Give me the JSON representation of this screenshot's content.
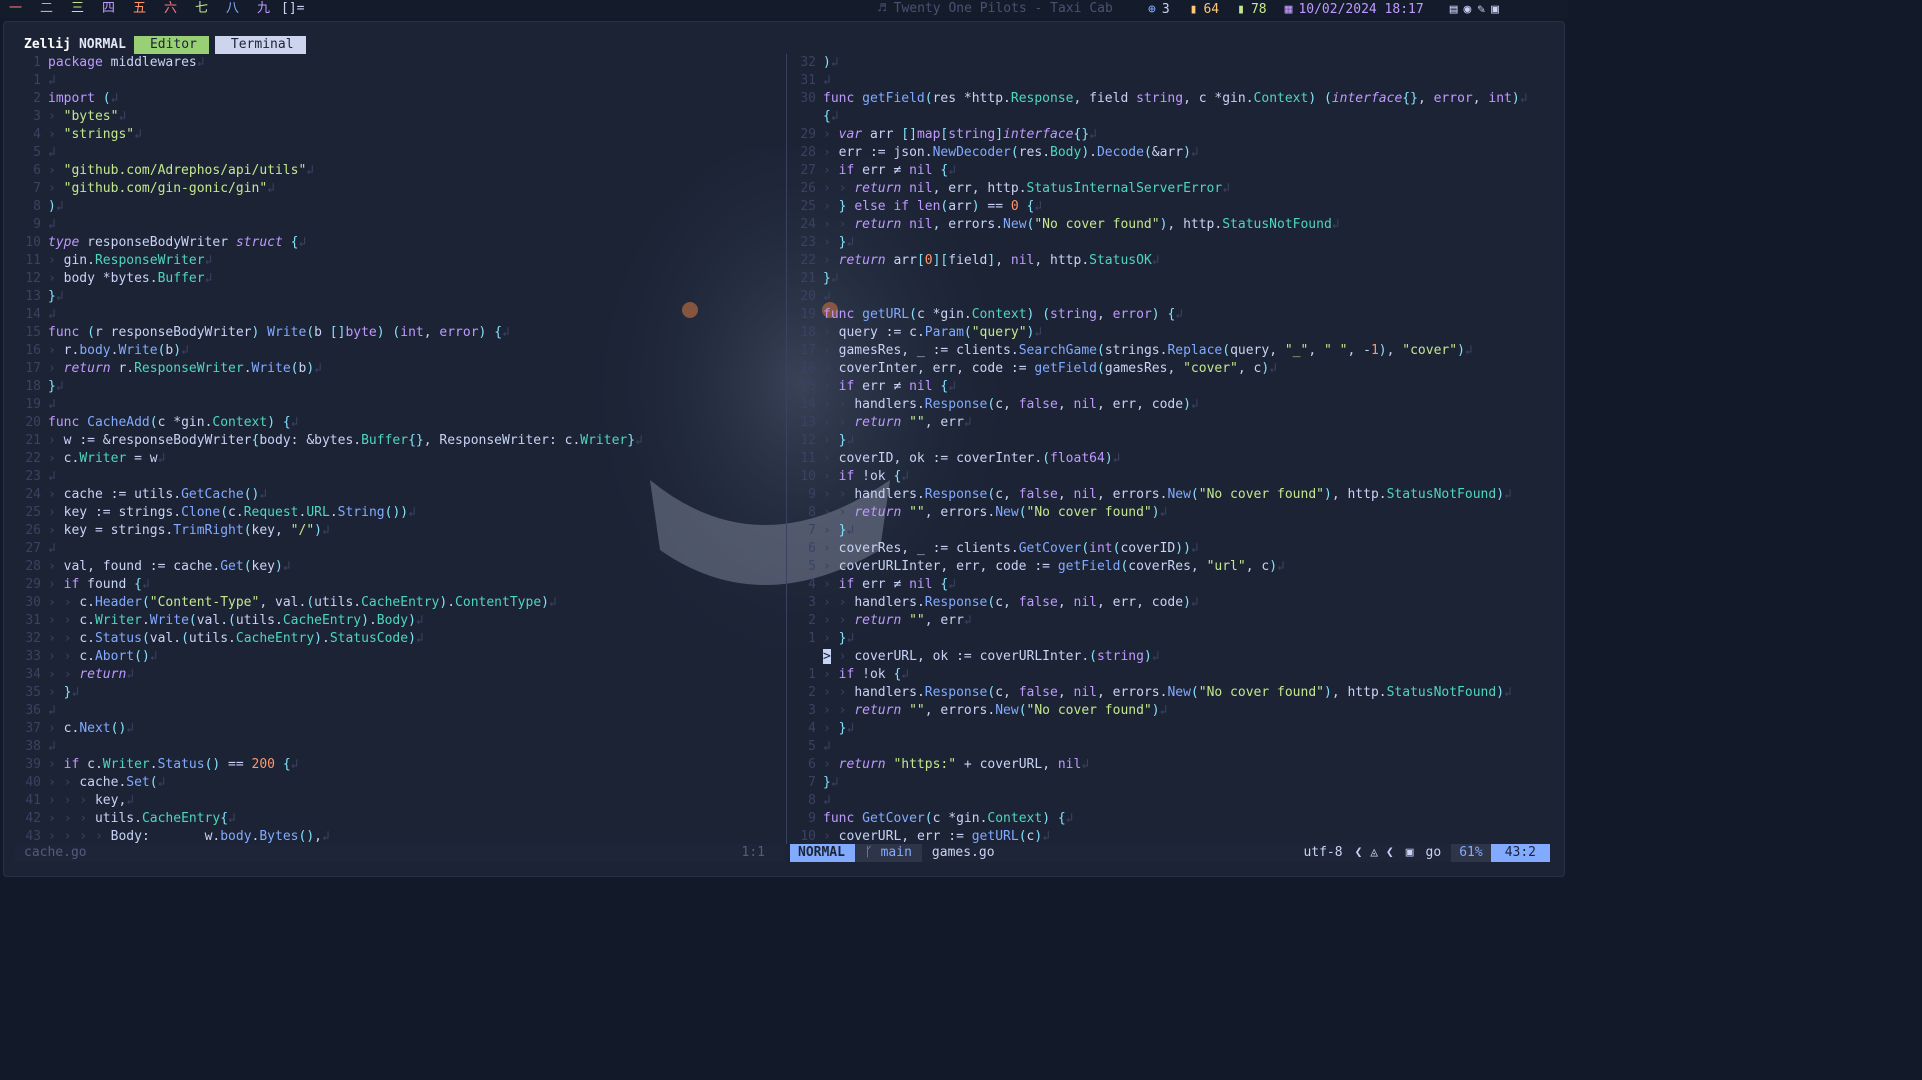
{
  "topbar": {
    "workspaces": [
      "一",
      "二",
      "三",
      "四",
      "五",
      "六",
      "七",
      "八",
      "九"
    ],
    "workspace_colors": [
      "#ff757f",
      "#ff966c",
      "#c3e88d",
      "#c099ff",
      "#ff966c",
      "#ff757f",
      "#c3e88d",
      "#82aaff",
      "#c099ff"
    ],
    "layout": "[]=",
    "music": "♬ Twenty One Pilots - Taxi Cab",
    "tray_count": "3",
    "cpu": "64",
    "battery": "78",
    "datetime": "10/02/2024 18:17"
  },
  "zellij": {
    "name": "Zellij",
    "mode": "NORMAL",
    "tabs": [
      {
        "label": "Editor",
        "active": true
      },
      {
        "label": "Terminal",
        "active": false
      }
    ]
  },
  "left_pane": {
    "filename": "cache.go",
    "position": "1:1",
    "numbers": [
      "1",
      "1",
      "2",
      "3",
      "4",
      "5",
      "6",
      "7",
      "8",
      "9",
      "10",
      "11",
      "12",
      "13",
      "14",
      "15",
      "16",
      "17",
      "18",
      "19",
      "20",
      "21",
      "22",
      "23",
      "24",
      "25",
      "26",
      "27",
      "28",
      "29",
      "30",
      "31",
      "32",
      "33",
      "34",
      "35",
      "36",
      "37",
      "38",
      "39",
      "40",
      "41",
      "42",
      "43"
    ],
    "lines": [
      "package middlewares",
      "",
      "import (",
      "\"bytes\"",
      "\"strings\"",
      "",
      "\"github.com/Adrephos/api/utils\"",
      "\"github.com/gin-gonic/gin\"",
      ")",
      "",
      "type responseBodyWriter struct {",
      "gin.ResponseWriter",
      "body *bytes.Buffer",
      "}",
      "",
      "func (r responseBodyWriter) Write(b []byte) (int, error) {",
      "r.body.Write(b)",
      "return r.ResponseWriter.Write(b)",
      "}",
      "",
      "func CacheAdd(c *gin.Context) {",
      "w := &responseBodyWriter{body: &bytes.Buffer{}, ResponseWriter: c.Writer}",
      "c.Writer = w",
      "",
      "cache := utils.GetCache()",
      "key := strings.Clone(c.Request.URL.String())",
      "key = strings.TrimRight(key, \"/\")",
      "",
      "val, found := cache.Get(key)",
      "if found {",
      "c.Header(\"Content-Type\", val.(utils.CacheEntry).ContentType)",
      "c.Writer.Write(val.(utils.CacheEntry).Body)",
      "c.Status(val.(utils.CacheEntry).StatusCode)",
      "c.Abort()",
      "return",
      "}",
      "",
      "c.Next()",
      "",
      "if c.Writer.Status() == 200 {",
      "cache.Set(",
      "key,",
      "utils.CacheEntry{",
      "Body:       w.body.Bytes(),"
    ]
  },
  "right_pane": {
    "filename": "games.go",
    "mode": "NORMAL",
    "branch": "main",
    "encoding": "utf-8",
    "filetype": "go",
    "percent": "61%",
    "position": "43:2",
    "numbers": [
      "32",
      "31",
      "30",
      "",
      "29",
      "28",
      "27",
      "26",
      "25",
      "24",
      "23",
      "22",
      "21",
      "20",
      "19",
      "18",
      "17",
      "16",
      "15",
      "14",
      "13",
      "12",
      "11",
      "10",
      "9",
      "8",
      "7",
      "6",
      "5",
      "4",
      "3",
      "2",
      "1",
      "",
      "1",
      "2",
      "3",
      "4",
      "5",
      "6",
      "7",
      "8",
      "9",
      "10"
    ],
    "lines": [
      ")",
      "",
      "func getField(res *http.Response, field string, c *gin.Context) (interface{}, error, int)",
      "{",
      "var arr []map[string]interface{}",
      "err := json.NewDecoder(res.Body).Decode(&arr)",
      "if err ≠ nil {",
      "return nil, err, http.StatusInternalServerError",
      "} else if len(arr) == 0 {",
      "return nil, errors.New(\"No cover found\"), http.StatusNotFound",
      "}",
      "return arr[0][field], nil, http.StatusOK",
      "}",
      "",
      "func getURL(c *gin.Context) (string, error) {",
      "query := c.Param(\"query\")",
      "gamesRes, _ := clients.SearchGame(strings.Replace(query, \"_\", \" \", -1), \"cover\")",
      "coverInter, err, code := getField(gamesRes, \"cover\", c)",
      "if err ≠ nil {",
      "handlers.Response(c, false, nil, err, code)",
      "return \"\", err",
      "}",
      "coverID, ok := coverInter.(float64)",
      "if !ok {",
      "handlers.Response(c, false, nil, errors.New(\"No cover found\"), http.StatusNotFound)",
      "return \"\", errors.New(\"No cover found\")",
      "}",
      "coverRes, _ := clients.GetCover(int(coverID))",
      "coverURLInter, err, code := getField(coverRes, \"url\", c)",
      "if err ≠ nil {",
      "handlers.Response(c, false, nil, err, code)",
      "return \"\", err",
      "}",
      "coverURL, ok := coverURLInter.(string)",
      "if !ok {",
      "handlers.Response(c, false, nil, errors.New(\"No cover found\"), http.StatusNotFound)",
      "return \"\", errors.New(\"No cover found\")",
      "}",
      "",
      "return \"https:\" + coverURL, nil",
      "}",
      "",
      "func GetCover(c *gin.Context) {",
      "coverURL, err := getURL(c)"
    ]
  }
}
